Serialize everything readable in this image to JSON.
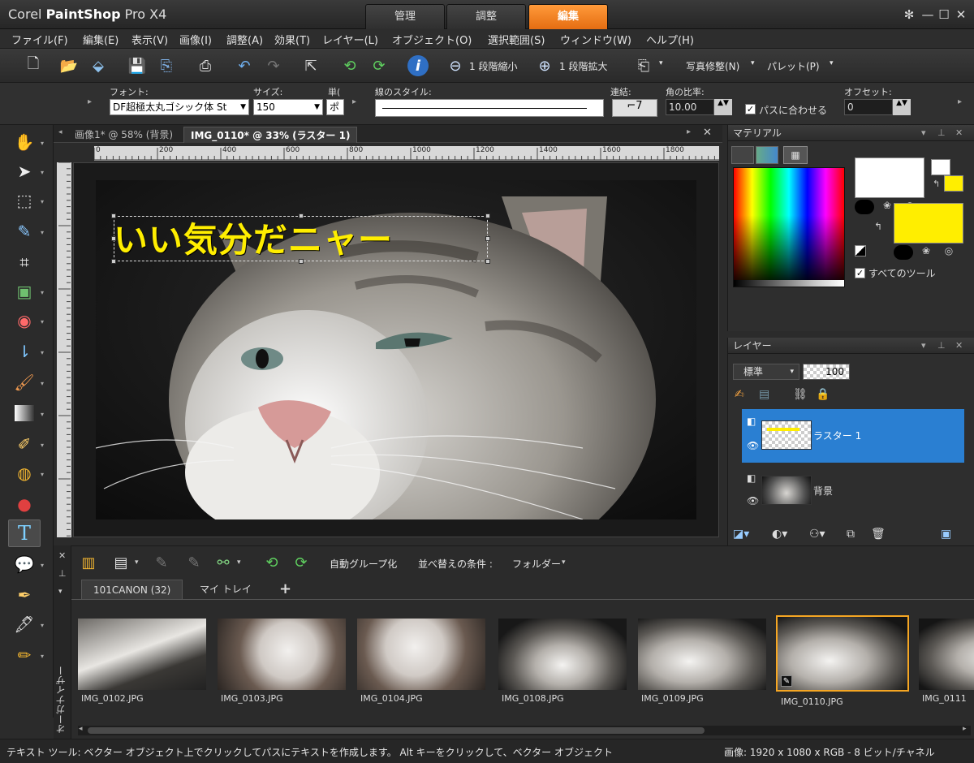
{
  "app": {
    "title_light": "Corel ",
    "title_bold": "PaintShop",
    "title_rest": " Pro X4",
    "tabs": [
      {
        "label": "管理"
      },
      {
        "label": "調整"
      },
      {
        "label": "編集"
      }
    ],
    "accent": "#f07f1e",
    "selection_blue": "#2a7fd2",
    "text_yellow": "#ffee00"
  },
  "menu": [
    "ファイル(F)",
    "編集(E)",
    "表示(V)",
    "画像(I)",
    "調整(A)",
    "効果(T)",
    "レイヤー(L)",
    "オブジェクト(O)",
    "選択範囲(S)",
    "ウィンドウ(W)",
    "ヘルプ(H)"
  ],
  "toolbar": {
    "zoom_out": "1 段階縮小",
    "zoom_in": "1 段階拡大",
    "photo_fix": "写真修整(N)",
    "palette": "パレット(P)",
    "icons": [
      "new-file-icon",
      "open-folder-icon",
      "scan-icon",
      "save-icon",
      "save-as-icon",
      "print-icon",
      "undo-icon",
      "redo-icon",
      "export-icon",
      "rotate-left-icon",
      "rotate-right-icon",
      "info-icon",
      "zoom-out-icon",
      "zoom-in-icon",
      "copy-icon"
    ]
  },
  "options": {
    "font_label": "フォント:",
    "font_value": "DF超極太丸ゴシック体 St",
    "size_label": "サイズ:",
    "size_value": "150",
    "unit_label": "単(",
    "unit_value": "ポ",
    "line_style_label": "線のスタイル:",
    "join_label": "連結:",
    "miter_label": "角の比率:",
    "miter_value": "10.00",
    "fit_path_label": "パスに合わせる",
    "offset_label": "オフセット:",
    "offset_value": "0"
  },
  "doc_tabs": [
    {
      "label": "画像1* @ 58% (背景)"
    },
    {
      "label": "IMG_0110* @ 33% (ラスター 1)"
    }
  ],
  "ruler_ticks": [
    "0",
    "200",
    "400",
    "600",
    "800",
    "1000",
    "1200",
    "1400",
    "1600",
    "1800"
  ],
  "canvas": {
    "text": "いい気分だニャー"
  },
  "materials": {
    "title": "マテリアル",
    "all_tools": "すべてのツール",
    "foreground": "#ffffff",
    "background": "#ffee00"
  },
  "layers": {
    "title": "レイヤー",
    "blend_mode": "標準",
    "opacity": "100",
    "items": [
      {
        "name": "ラスター 1"
      },
      {
        "name": "背景"
      }
    ]
  },
  "organizer": {
    "side_label": "オーガナイザー",
    "auto_group": "自動グループ化",
    "sort_label": "並べ替えの条件 :",
    "sort_value": "フォルダー",
    "tabs": [
      {
        "label": "101CANON (32)"
      },
      {
        "label": "マイ トレイ"
      }
    ],
    "add_tab": "+",
    "thumbnails": [
      {
        "name": "IMG_0102.JPG"
      },
      {
        "name": "IMG_0103.JPG"
      },
      {
        "name": "IMG_0104.JPG"
      },
      {
        "name": "IMG_0108.JPG"
      },
      {
        "name": "IMG_0109.JPG"
      },
      {
        "name": "IMG_0110.JPG"
      },
      {
        "name": "IMG_0111"
      }
    ]
  },
  "status": {
    "left": "テキスト ツール: ベクター オブジェクト上でクリックしてパスにテキストを作成します。 Alt キーをクリックして、ベクター オブジェクト",
    "right": "画像: 1920 x 1080 x RGB - 8 ビット/チャネル"
  }
}
